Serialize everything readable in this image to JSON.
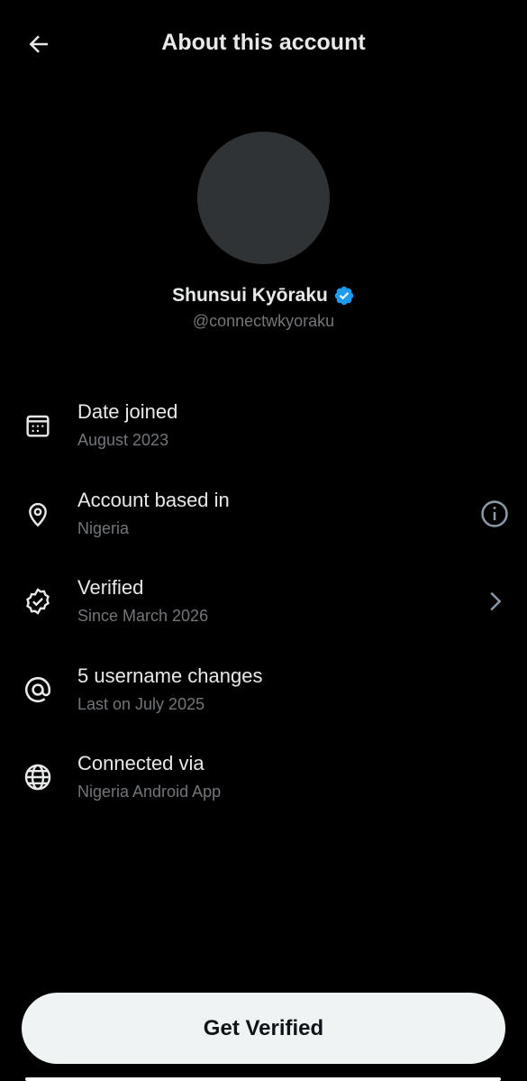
{
  "header": {
    "title": "About this account",
    "back_icon": "arrow-left-icon"
  },
  "profile": {
    "display_name": "Shunsui Kyōraku",
    "handle": "@connectwkyoraku",
    "verified_badge_color": "#1d9bf0",
    "avatar_color": "#2f3336"
  },
  "info": {
    "items": [
      {
        "icon": "calendar-icon",
        "title": "Date joined",
        "subtitle": "August 2023"
      },
      {
        "icon": "location-pin-icon",
        "title": "Account based in",
        "subtitle": "Nigeria",
        "trailing": "info-icon"
      },
      {
        "icon": "verified-badge-icon",
        "title": "Verified",
        "subtitle": "Since March 2026",
        "trailing": "chevron-right-icon"
      },
      {
        "icon": "at-sign-icon",
        "title": "5 username changes",
        "subtitle": "Last on July 2025"
      },
      {
        "icon": "globe-icon",
        "title": "Connected via",
        "subtitle": "Nigeria Android App"
      }
    ]
  },
  "cta": {
    "label": "Get Verified"
  },
  "colors": {
    "background": "#000000",
    "primary_text": "#e7e9ea",
    "secondary_text": "#71767b",
    "button_bg": "#eff3f4",
    "button_text": "#0f1419"
  }
}
